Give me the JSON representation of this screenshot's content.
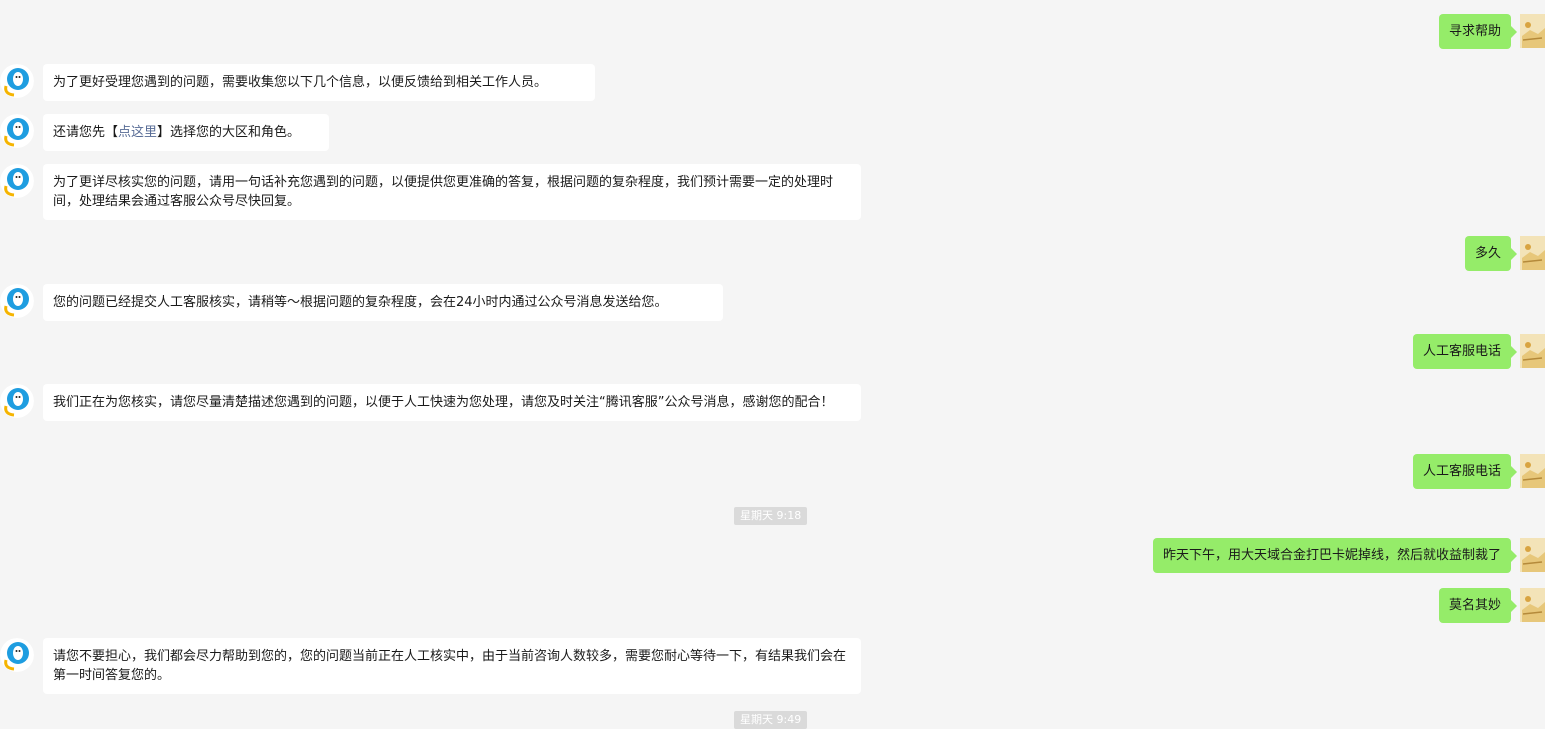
{
  "messages": [
    {
      "side": "right",
      "text": "寻求帮助"
    },
    {
      "side": "left",
      "text": "为了更好受理您遇到的问题，需要收集您以下几个信息，以便反馈给到相关工作人员。"
    },
    {
      "side": "left",
      "prefix": "还请您先【",
      "link": "点这里",
      "suffix": "】选择您的大区和角色。"
    },
    {
      "side": "left",
      "text": "为了更详尽核实您的问题，请用一句话补充您遇到的问题，以便提供您更准确的答复，根据问题的复杂程度，我们预计需要一定的处理时间，处理结果会通过客服公众号尽快回复。"
    },
    {
      "side": "right",
      "text": "多久"
    },
    {
      "side": "left",
      "text": "您的问题已经提交人工客服核实，请稍等～根据问题的复杂程度，会在24小时内通过公众号消息发送给您。"
    },
    {
      "side": "right",
      "text": "人工客服电话"
    },
    {
      "side": "left",
      "text": "我们正在为您核实，请您尽量清楚描述您遇到的问题，以便于人工快速为您处理，请您及时关注“腾讯客服”公众号消息，感谢您的配合！"
    },
    {
      "side": "right",
      "text": "人工客服电话"
    },
    {
      "side": "time",
      "text": "星期天 9:18"
    },
    {
      "side": "right",
      "text": "昨天下午，用大天域合金打巴卡妮掉线，然后就收益制裁了"
    },
    {
      "side": "right",
      "text": "莫名其妙"
    },
    {
      "side": "left",
      "text": "请您不要担心，我们都会尽力帮助到您的，您的问题当前正在人工核实中，由于当前咨询人数较多，需要您耐心等待一下，有结果我们会在第一时间答复您的。"
    },
    {
      "side": "time",
      "text": "星期天 9:49"
    }
  ],
  "icons": {
    "bot": "qq-penguin-avatar-icon",
    "user": "user-avatar-icon"
  },
  "colors": {
    "background": "#f5f5f5",
    "left_bubble": "#ffffff",
    "right_bubble": "#95ec69",
    "link": "#576b95",
    "timestamp_bg": "#dadada"
  }
}
